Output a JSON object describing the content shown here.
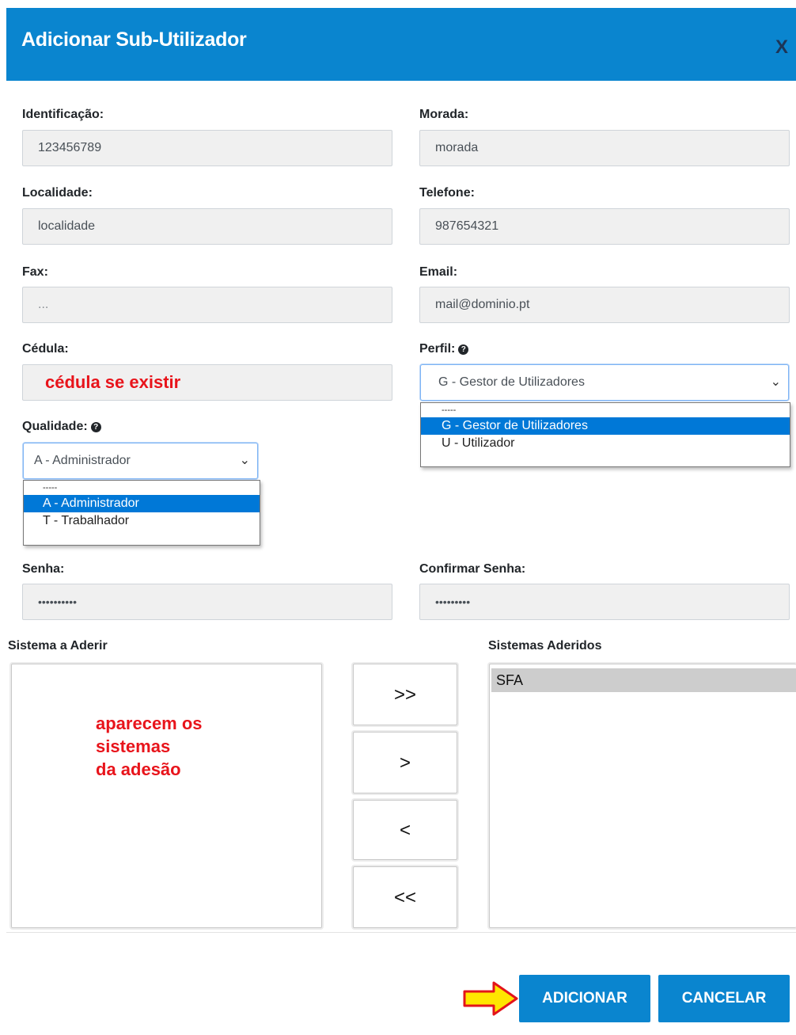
{
  "dialog": {
    "title": "Adicionar Sub-Utilizador",
    "close_label": "X"
  },
  "fields": {
    "identificacao": {
      "label": "Identificação:",
      "value": "123456789"
    },
    "morada": {
      "label": "Morada:",
      "value": "morada"
    },
    "localidade": {
      "label": "Localidade:",
      "value": "localidade"
    },
    "telefone": {
      "label": "Telefone:",
      "value": "987654321"
    },
    "fax": {
      "label": "Fax:",
      "placeholder": "..."
    },
    "email": {
      "label": "Email:",
      "value": "mail@dominio.pt"
    },
    "cedula": {
      "label": "Cédula:",
      "note": "cédula se existir"
    },
    "perfil": {
      "label": "Perfil:",
      "selected": "G - Gestor de Utilizadores",
      "options": [
        "-----",
        "G - Gestor de Utilizadores",
        "U - Utilizador"
      ]
    },
    "qualidade": {
      "label": "Qualidade:",
      "selected": "A - Administrador",
      "options": [
        "-----",
        "A - Administrador",
        "T - Trabalhador"
      ]
    },
    "senha": {
      "label": "Senha:",
      "value": "••••••••••"
    },
    "confirmar_senha": {
      "label": "Confirmar Senha:",
      "value": "•••••••••"
    }
  },
  "systems": {
    "available_label": "Sistema a Aderir",
    "available_note": [
      "aparecem os",
      "sistemas",
      "da adesão"
    ],
    "joined_label": "Sistemas Aderidos",
    "joined_items": [
      "SFA"
    ],
    "buttons": {
      "add_all": ">>",
      "add": ">",
      "remove": "<",
      "remove_all": "<<"
    }
  },
  "footer": {
    "add_label": "ADICIONAR",
    "cancel_label": "CANCELAR"
  },
  "colors": {
    "header": "#0a85cf",
    "note": "#e8141b",
    "highlight_arrow": "#ffe600"
  },
  "icons": {
    "help": "question-circle-icon",
    "select_chevron": "chevron-down-icon",
    "callout_arrow": "arrow-right-icon"
  }
}
